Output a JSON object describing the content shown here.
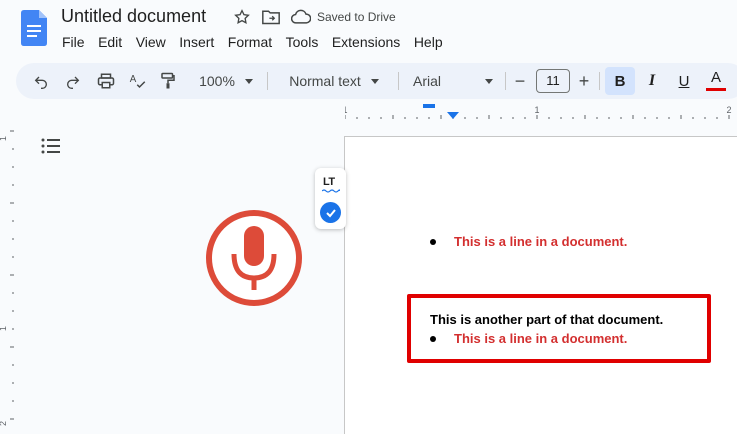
{
  "app": {
    "document_title": "Untitled document",
    "saved_status": "Saved to Drive"
  },
  "menu": [
    "File",
    "Edit",
    "View",
    "Insert",
    "Format",
    "Tools",
    "Extensions",
    "Help"
  ],
  "toolbar": {
    "zoom": "100%",
    "style": "Normal text",
    "font": "Arial",
    "font_size": "11",
    "minus": "−",
    "plus": "+",
    "bold_label": "B",
    "italic_label": "I",
    "underline_label": "U",
    "text_color_label": "A"
  },
  "rulers": {
    "top_marks": [
      "1",
      "1",
      "2"
    ],
    "left_marks": [
      "1",
      "1",
      "2"
    ]
  },
  "grammar_widget": {
    "label": "LT"
  },
  "document": {
    "line1": "This is a line in a document.",
    "line2": "This is another part of that document.",
    "line3": "This is a line in a document."
  },
  "colors": {
    "accent_blue": "#1a73e8",
    "doc_red_text": "#d32f2f",
    "highlight_box": "#e00000",
    "mic_red": "#dd4b39",
    "text_color_bar": "#e00000"
  },
  "icons": [
    "docs-logo-icon",
    "star-icon",
    "move-to-folder-icon",
    "cloud-saved-icon",
    "undo-icon",
    "redo-icon",
    "print-icon",
    "spellcheck-icon",
    "paint-format-icon",
    "outline-icon",
    "microphone-icon",
    "check-icon"
  ]
}
